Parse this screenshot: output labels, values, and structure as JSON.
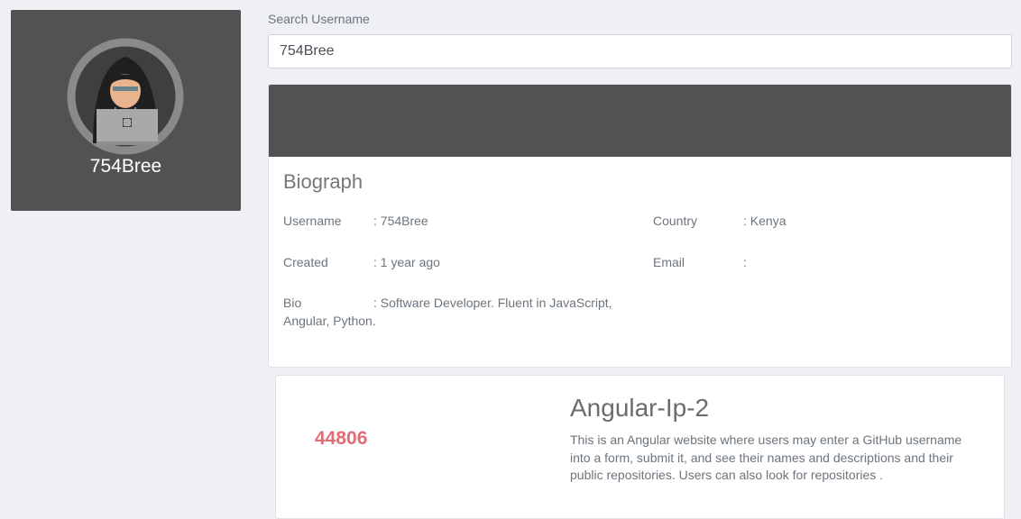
{
  "profile": {
    "username": "754Bree",
    "avatar_icon": "hacker-avatar-icon"
  },
  "search": {
    "label": "Search Username",
    "value": "754Bree"
  },
  "biograph": {
    "title": "Biograph",
    "username_label": "Username",
    "username_value": ": 754Bree",
    "country_label": "Country",
    "country_value": ": Kenya",
    "created_label": "Created",
    "created_value": ": 1 year ago",
    "email_label": "Email",
    "email_value": ":",
    "bio_label": "Bio",
    "bio_value": ": Software Developer. Fluent in JavaScript,",
    "bio_value_cont": "Angular, Python."
  },
  "repo": {
    "count": "44806",
    "name": "Angular-Ip-2",
    "description": "This is an Angular website where users may enter a GitHub username into a form, submit it, and see their names and descriptions and their public repositories. Users can also look for repositories ."
  },
  "colors": {
    "card_dark": "#525252",
    "page_bg": "#eef0f5",
    "accent_count": "#e06c75"
  }
}
